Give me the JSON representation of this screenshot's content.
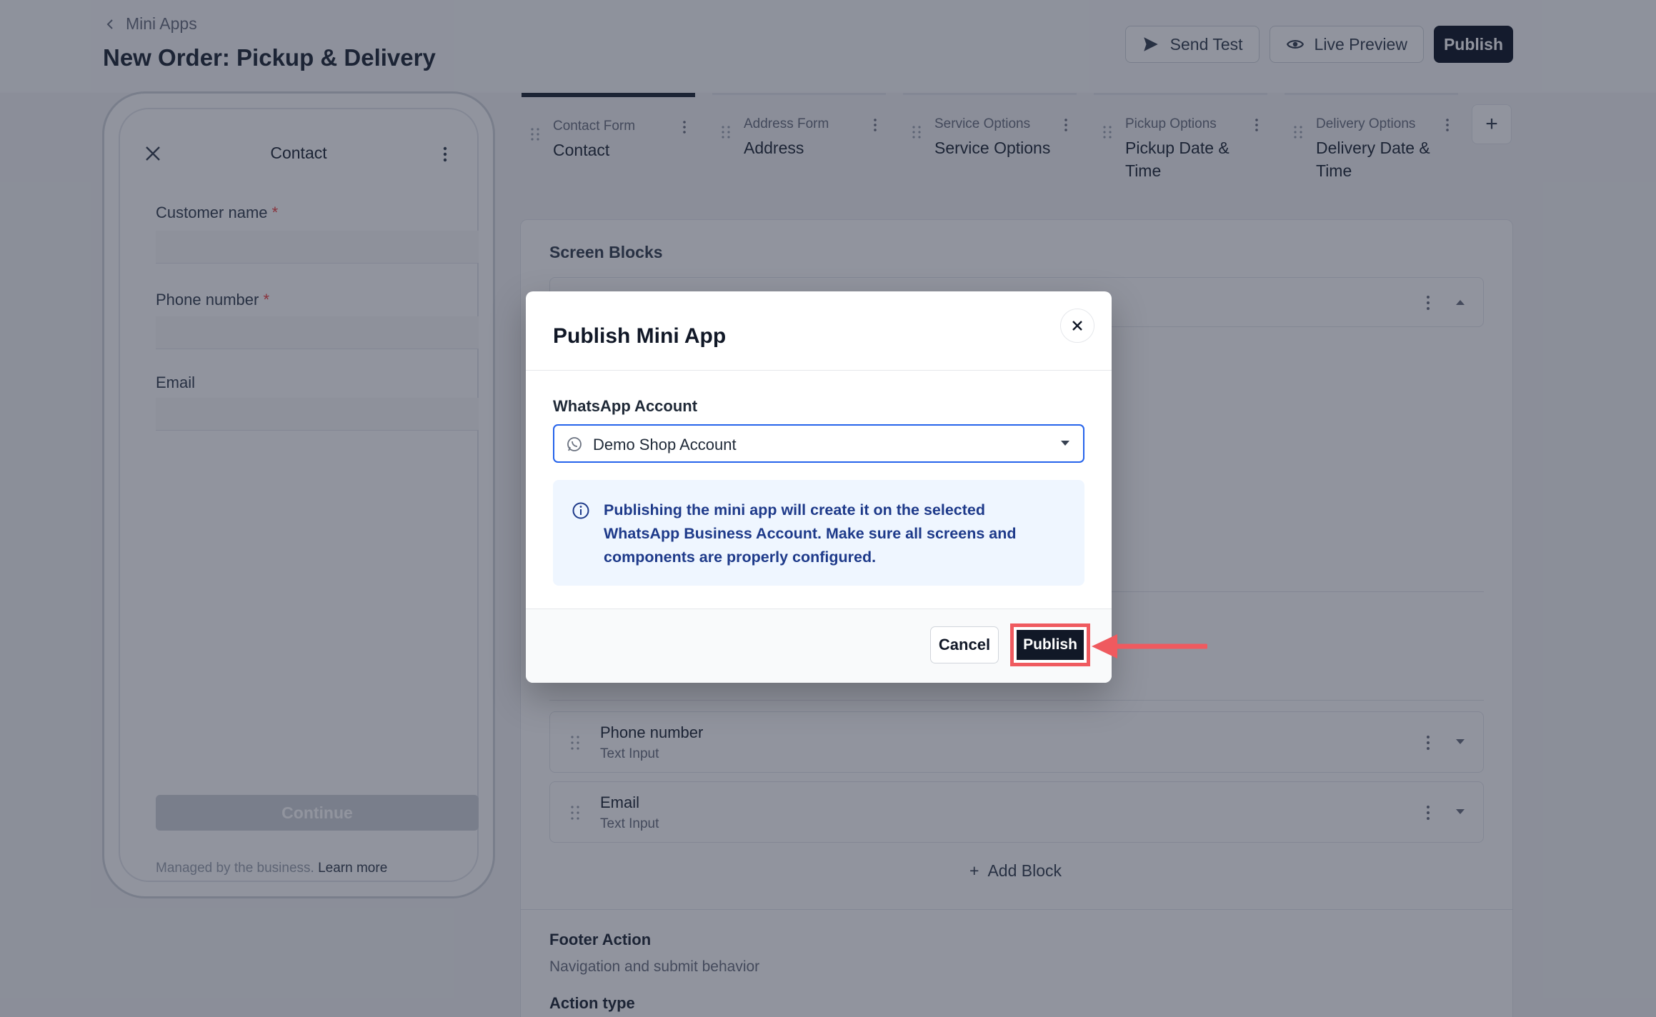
{
  "nav": {
    "back_label": "Mini Apps"
  },
  "page": {
    "title": "New Order: Pickup & Delivery"
  },
  "toolbar": {
    "send_test": "Send Test",
    "live_preview": "Live Preview",
    "publish": "Publish"
  },
  "phone": {
    "header_title": "Contact",
    "fields": [
      {
        "label": "Customer name",
        "required": "*"
      },
      {
        "label": "Phone number",
        "required": "*"
      },
      {
        "label": "Email",
        "required": ""
      }
    ],
    "continue_label": "Continue",
    "managed_text": "Managed by the business.",
    "learn_more": "Learn more"
  },
  "tabs": [
    {
      "kicker": "Contact Form",
      "name": "Contact"
    },
    {
      "kicker": "Address Form",
      "name": "Address"
    },
    {
      "kicker": "Service Options",
      "name": "Service Options"
    },
    {
      "kicker": "Pickup Options",
      "name": "Pickup Date & Time"
    },
    {
      "kicker": "Delivery Options",
      "name": "Delivery Date & Time"
    }
  ],
  "tab_add": "+",
  "editor": {
    "section_title": "Screen Blocks",
    "blocks": [
      {
        "title": "Phone number",
        "subtitle": "Text Input"
      },
      {
        "title": "Email",
        "subtitle": "Text Input"
      }
    ],
    "add_block": "Add Block",
    "footer_title": "Footer Action",
    "footer_subtitle": "Navigation and submit behavior",
    "action_type": "Action type"
  },
  "modal": {
    "title": "Publish Mini App",
    "account_label": "WhatsApp Account",
    "account_value": "Demo Shop Account",
    "info_text": "Publishing the mini app will create it on the selected WhatsApp Business Account. Make sure all screens and components are properly configured.",
    "cancel_label": "Cancel",
    "publish_label": "Publish"
  },
  "colors": {
    "accent": "#2563eb",
    "dark": "#111827",
    "annotation": "#ef5a5f",
    "info_bg": "#eff6ff"
  }
}
